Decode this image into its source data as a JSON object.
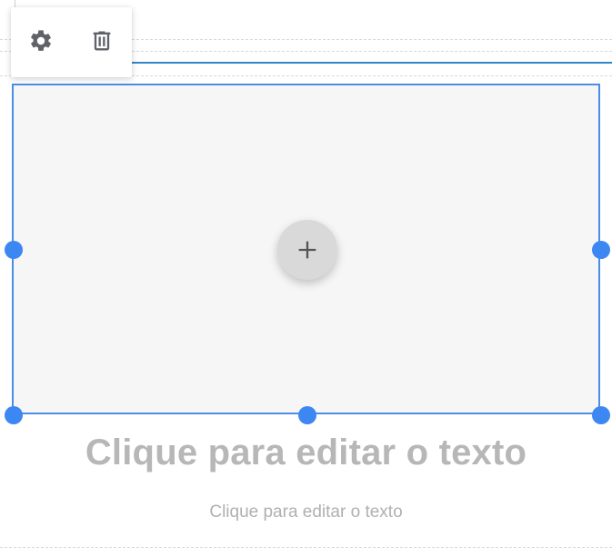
{
  "toolbar": {
    "items": [
      {
        "icon": "gear-icon"
      },
      {
        "icon": "trash-icon"
      }
    ]
  },
  "image_block": {
    "add_icon": "plus-icon",
    "border_color": "#4a8ee8",
    "handle_color": "#3d87f3",
    "background": "#f6f6f6"
  },
  "content": {
    "title": "Clique para editar o texto",
    "body": "Clique para editar o texto"
  },
  "colors": {
    "selection_line": "#2f86c8",
    "text_placeholder": "#b7b7b7"
  }
}
